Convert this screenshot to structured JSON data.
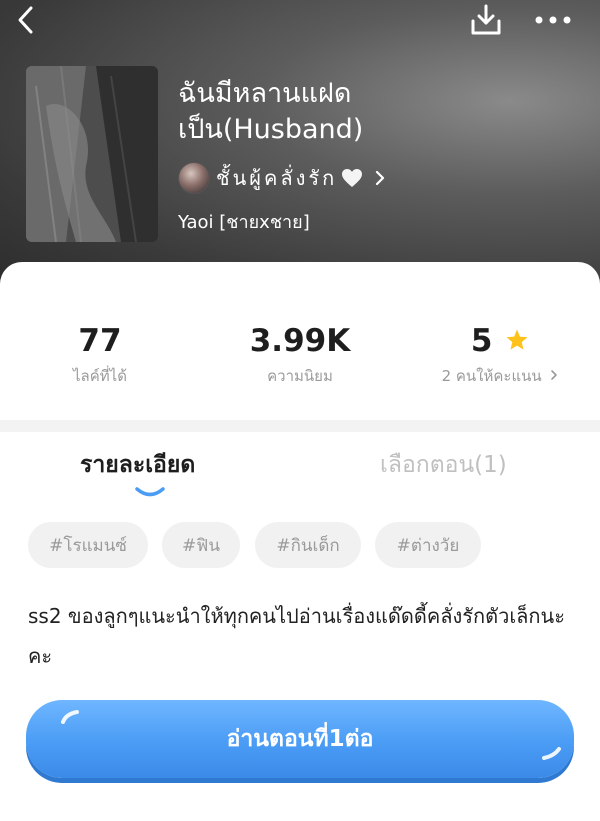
{
  "header": {
    "title_line1": "ฉันมีหลานแฝด",
    "title_line2": "เป็น(Husband)",
    "author_name": "ชั้นผู้คลั่งรัก",
    "genre": "Yaoi [ชายxชาย]"
  },
  "stats": {
    "likes": {
      "value": "77",
      "label": "ไลค์ที่ได้"
    },
    "views": {
      "value": "3.99K",
      "label": "ความนิยม"
    },
    "rating": {
      "value": "5",
      "label": "2 คนให้คะแนน"
    }
  },
  "tabs": {
    "details": "รายละเอียด",
    "episodes": "เลือกตอน(1)"
  },
  "tags": [
    "#โรแมนซ์",
    "#ฟิน",
    "#กินเด็ก",
    "#ต่างวัย"
  ],
  "description": "ss2 ของลูกๆแนะนำให้ทุกคนไปอ่านเรื่องแด๊ดดี้คลั่งรักตัวเล็กนะคะ",
  "read_button": "อ่านตอนที่1ต่อ",
  "colors": {
    "accent": "#4a9cf5",
    "star": "#ffc21a",
    "header_bg": "#3a3a3a"
  }
}
